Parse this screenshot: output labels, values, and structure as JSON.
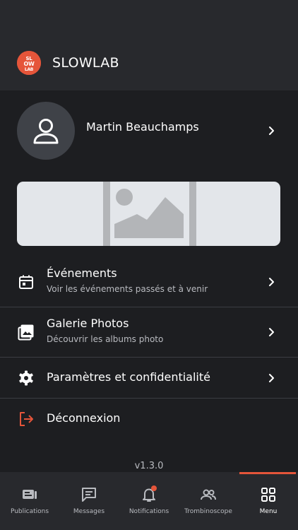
{
  "header": {
    "logo_text": "SLOW LAB",
    "brand": "SLOWLAB"
  },
  "profile": {
    "name": "Martin Beauchamps"
  },
  "menu": [
    {
      "title": "Événements",
      "subtitle": "Voir les événements passés et à venir"
    },
    {
      "title": "Galerie Photos",
      "subtitle": "Découvrir les albums photo"
    },
    {
      "title": "Paramètres et confidentialité"
    },
    {
      "title": "Déconnexion"
    }
  ],
  "version": "v1.3.0",
  "tabs": [
    {
      "label": "Publications",
      "icon": "publications-icon"
    },
    {
      "label": "Messages",
      "icon": "messages-icon"
    },
    {
      "label": "Notifications",
      "icon": "bell-icon"
    },
    {
      "label": "Trombinoscope",
      "icon": "people-icon"
    },
    {
      "label": "Menu",
      "icon": "grid-icon",
      "active": true
    }
  ],
  "colors": {
    "accent": "#e5553a",
    "background": "#1d1e21",
    "header": "#28292d"
  }
}
